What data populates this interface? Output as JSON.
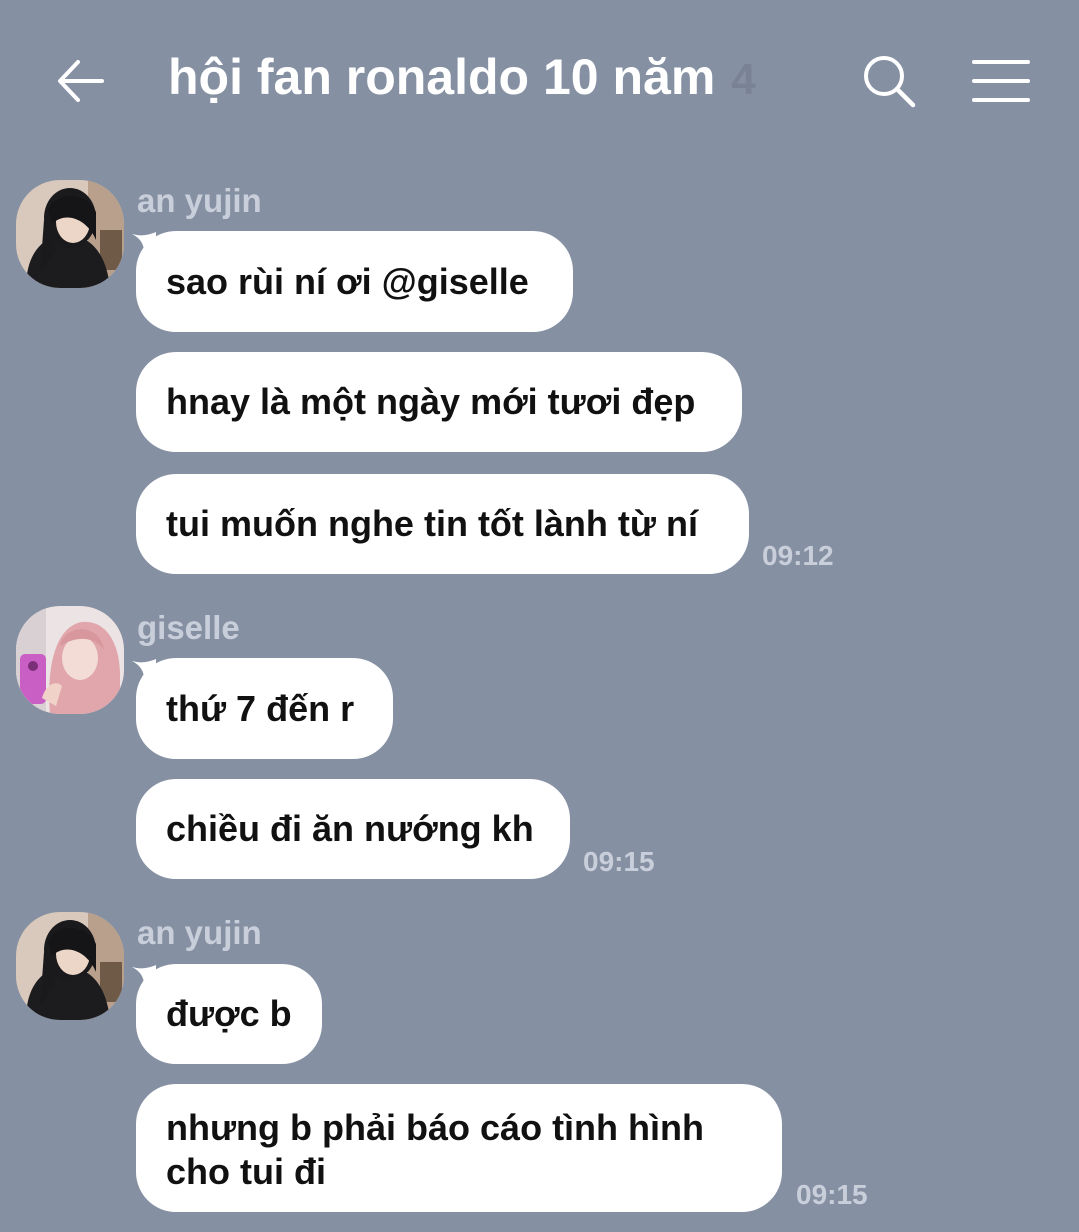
{
  "header": {
    "title": "hội fan ronaldo 10 năm",
    "member_count": "4",
    "back_icon": "arrow-left-icon",
    "search_icon": "search-icon",
    "menu_icon": "hamburger-menu-icon"
  },
  "messages": [
    {
      "sender": "an yujin",
      "bubbles": [
        "sao rùi ní ơi @giselle",
        "hnay là một ngày mới tươi đẹp",
        "tui muốn nghe tin tốt lành từ ní"
      ],
      "time": "09:12"
    },
    {
      "sender": "giselle",
      "bubbles": [
        "thứ 7 đến r",
        "chiều đi ăn nướng kh"
      ],
      "time": "09:15"
    },
    {
      "sender": "an yujin",
      "bubbles": [
        "được b",
        "nhưng b phải báo cáo tình hình cho tui đi"
      ],
      "time": "09:15"
    }
  ],
  "colors": {
    "background": "#8690a3",
    "bubble": "#ffffff",
    "meta_text": "#c9cfda"
  }
}
